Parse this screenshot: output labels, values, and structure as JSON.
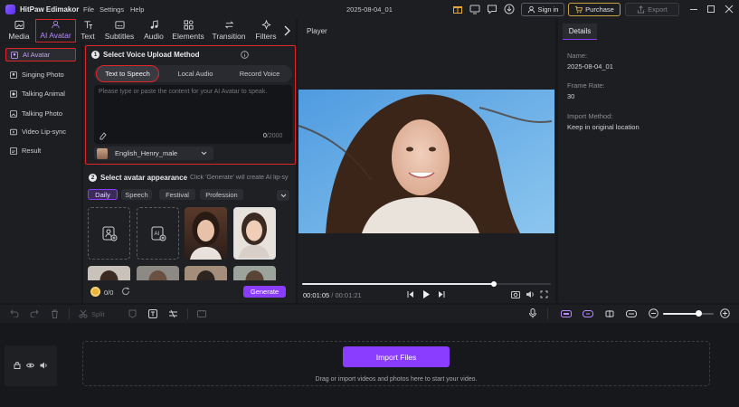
{
  "app": {
    "title": "HitPaw Edimakor",
    "menu": [
      "File",
      "Settings",
      "Help"
    ],
    "project_name": "2025-08-04_01",
    "sign_in": "Sign in",
    "purchase": "Purchase",
    "export": "Export"
  },
  "toolbar": {
    "items": [
      {
        "label": "Media",
        "icon": "media-icon"
      },
      {
        "label": "AI Avatar",
        "icon": "ai-avatar-icon"
      },
      {
        "label": "Text",
        "icon": "text-icon"
      },
      {
        "label": "Subtitles",
        "icon": "subtitles-icon"
      },
      {
        "label": "Audio",
        "icon": "audio-icon"
      },
      {
        "label": "Elements",
        "icon": "elements-icon"
      },
      {
        "label": "Transition",
        "icon": "transition-icon"
      },
      {
        "label": "Filters",
        "icon": "filters-icon"
      }
    ]
  },
  "sidebar": {
    "items": [
      {
        "label": "AI Avatar",
        "active": true
      },
      {
        "label": "Singing Photo"
      },
      {
        "label": "Talking Animal"
      },
      {
        "label": "Talking Photo"
      },
      {
        "label": "Video Lip-sync"
      },
      {
        "label": "Result"
      }
    ]
  },
  "voice": {
    "step": "1",
    "title": "Select Voice Upload Method",
    "tabs": [
      "Text to Speech",
      "Local Audio",
      "Record Voice"
    ],
    "placeholder": "Please type or paste the content for your AI Avatar to speak.",
    "counter_value": "0",
    "counter_max": "/2000",
    "voice_name": "English_Henry_male"
  },
  "appearance": {
    "step": "2",
    "title": "Select avatar appearance",
    "hint": "Click 'Generate' will create AI lip-sy",
    "categories": [
      "Daily",
      "Speech",
      "Festival",
      "Profession"
    ]
  },
  "generate": {
    "credits": "0/0",
    "button": "Generate"
  },
  "player": {
    "title": "Player",
    "current_time": "00:01:05",
    "separator": "/",
    "total_time": "00:01:21",
    "progress": 0.77
  },
  "details": {
    "tab": "Details",
    "fields": [
      {
        "label": "Name:",
        "value": "2025-08-04_01"
      },
      {
        "label": "Frame Rate:",
        "value": "30"
      },
      {
        "label": "Import Method:",
        "value": "Keep in original location"
      }
    ]
  },
  "timeline": {
    "split": "Split",
    "import_button": "Import Files",
    "import_hint": "Drag or import videos and photos here to start your video.",
    "zoom": 0.7
  },
  "colors": {
    "accent": "#8b3dff",
    "red_outline": "#e0242a",
    "bg": "#17181b"
  }
}
